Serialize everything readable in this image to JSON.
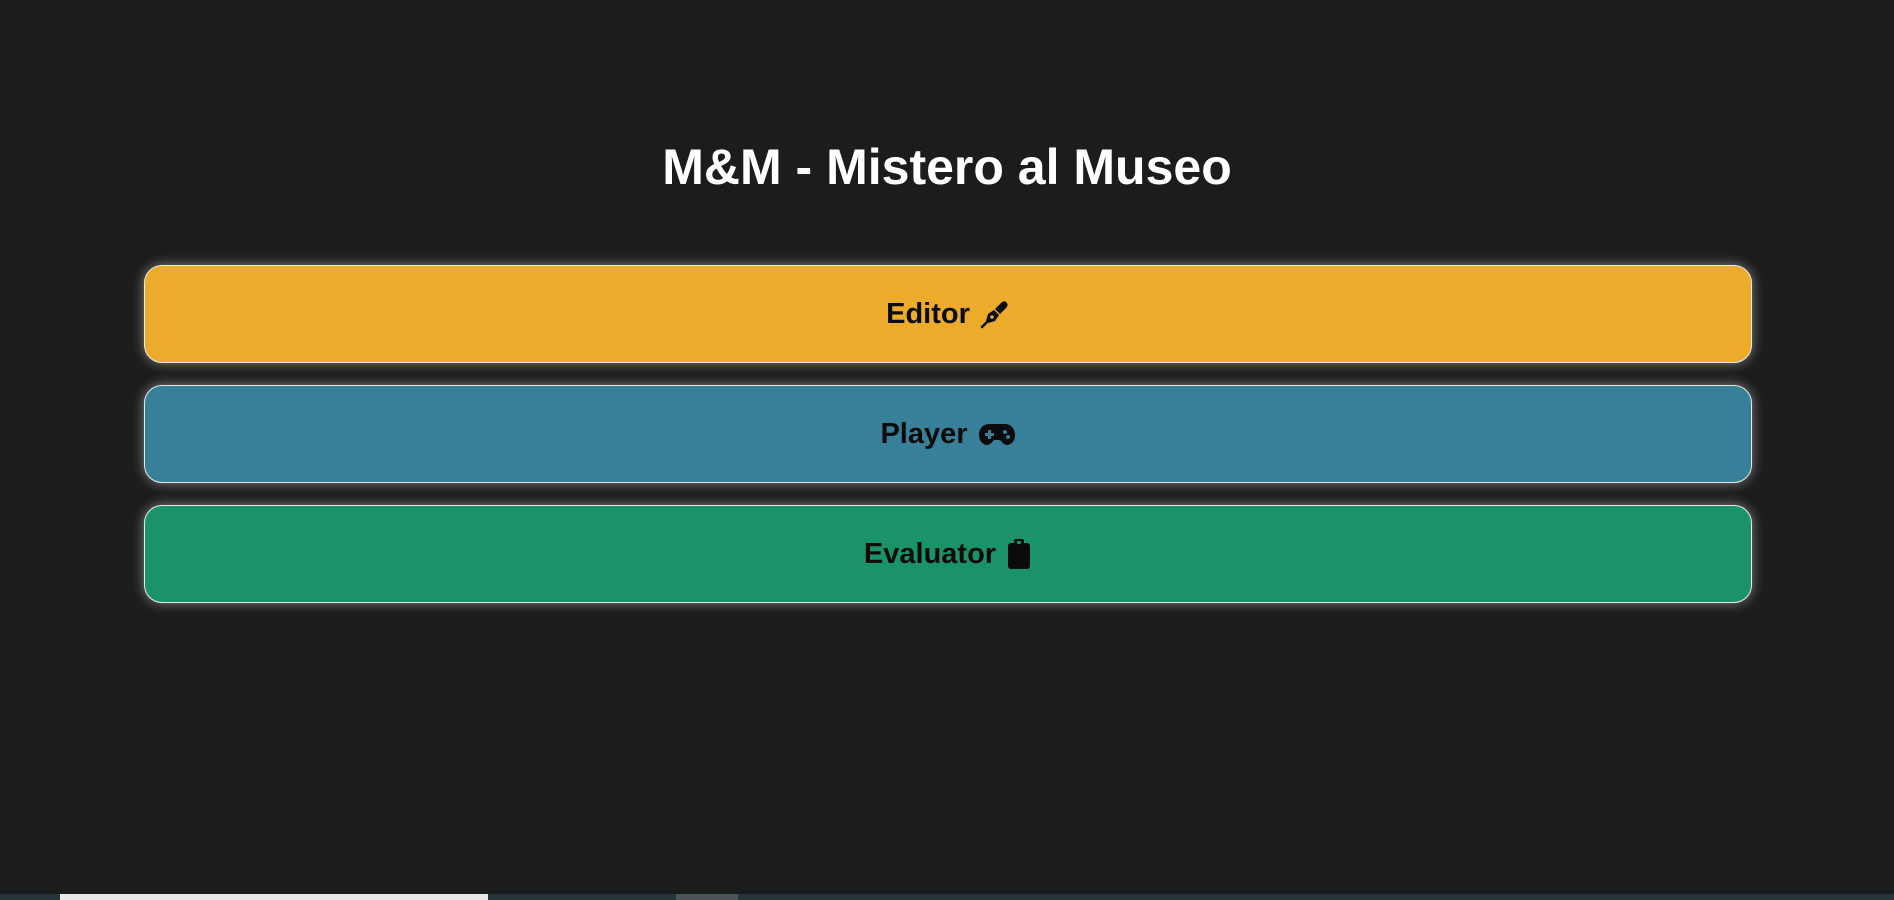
{
  "app": {
    "title": "M&M - Mistero al Museo"
  },
  "menu": {
    "items": [
      {
        "label": "Editor",
        "icon": "pen-nib-icon",
        "color": "#ecab2b"
      },
      {
        "label": "Player",
        "icon": "gamepad-icon",
        "color": "#38809a"
      },
      {
        "label": "Evaluator",
        "icon": "clipboard-icon",
        "color": "#1b936a"
      }
    ]
  },
  "theme": {
    "background": "#1d1c1d",
    "text": "#ffffff"
  }
}
